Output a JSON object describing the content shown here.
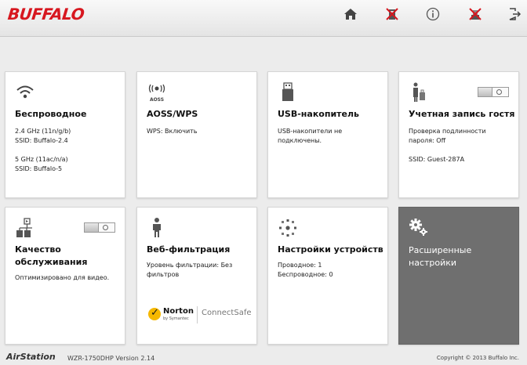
{
  "header": {
    "logo": "BUFFALO",
    "icons": [
      "home-icon",
      "wireless-off-icon",
      "info-icon",
      "usb-off-icon",
      "logout-icon"
    ]
  },
  "tiles": {
    "wireless": {
      "title": "Беспроводное",
      "lines": [
        "2.4 GHz (11n/g/b)",
        "SSID: Buffalo-2.4",
        "",
        "5 GHz (11ac/n/a)",
        "SSID: Buffalo-5"
      ]
    },
    "aoss": {
      "icon_label": "AOSS",
      "title": "AOSS/WPS",
      "lines": [
        "WPS: Включить"
      ]
    },
    "usb": {
      "title": "USB-накопитель",
      "lines": [
        "USB-накопители не",
        "подключены."
      ]
    },
    "guest": {
      "title": "Учетная запись гостя",
      "lines": [
        "Проверка подлинности",
        "пароля: Off",
        "",
        "SSID: Guest-287A"
      ]
    },
    "qos": {
      "title": "Качество обслуживания",
      "lines": [
        "Оптимизировано для видео."
      ]
    },
    "web": {
      "title": "Веб-фильтрация",
      "lines": [
        "Уровень фильтрации: Без",
        "фильтров"
      ],
      "norton": "Norton",
      "norton_sub": "by Symantec",
      "connectsafe": "ConnectSafe"
    },
    "devices": {
      "title": "Настройки устройств",
      "lines": [
        "Проводное: 1",
        "Беспроводное: 0"
      ]
    },
    "advanced": {
      "title": "Расширенные настройки"
    }
  },
  "footer": {
    "brand": "AirStation",
    "model": "WZR-1750DHP  Version 2.14",
    "copyright": "Copyright © 2013 Buffalo Inc."
  },
  "colors": {
    "logo": "#d7171f",
    "advanced_tile": "#6f6f6f"
  }
}
